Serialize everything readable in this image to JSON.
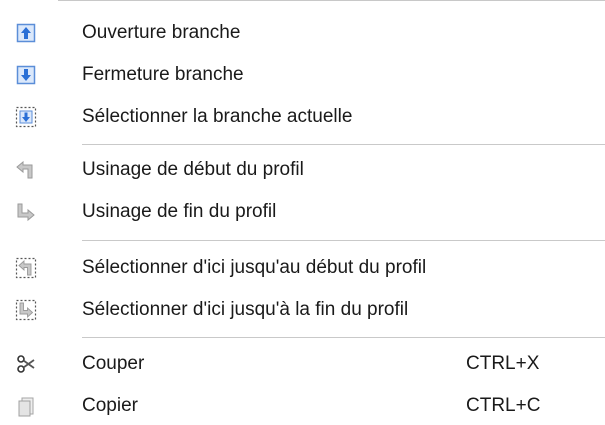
{
  "menu": {
    "groups": [
      {
        "items": [
          {
            "label": "Ouverture branche",
            "icon": "arrow-up-box-icon"
          },
          {
            "label": "Fermeture branche",
            "icon": "arrow-down-box-icon"
          },
          {
            "label": "Sélectionner la branche actuelle",
            "icon": "select-branch-icon"
          }
        ]
      },
      {
        "items": [
          {
            "label": "Usinage de début du profil",
            "icon": "profile-start-icon"
          },
          {
            "label": "Usinage de fin du profil",
            "icon": "profile-end-icon"
          }
        ]
      },
      {
        "items": [
          {
            "label": "Sélectionner d'ici jusqu'au début du profil",
            "icon": "select-to-start-icon"
          },
          {
            "label": "Sélectionner d'ici jusqu'à la fin du profil",
            "icon": "select-to-end-icon"
          }
        ]
      },
      {
        "items": [
          {
            "label": "Couper",
            "shortcut": "CTRL+X",
            "icon": "scissors-icon"
          },
          {
            "label": "Copier",
            "shortcut": "CTRL+C",
            "icon": "copy-icon"
          }
        ]
      }
    ]
  },
  "colors": {
    "icon_blue": "#2a6fd6",
    "icon_gray": "#9a9a9a",
    "separator": "#c9c9c9",
    "text": "#1a1a1a"
  }
}
